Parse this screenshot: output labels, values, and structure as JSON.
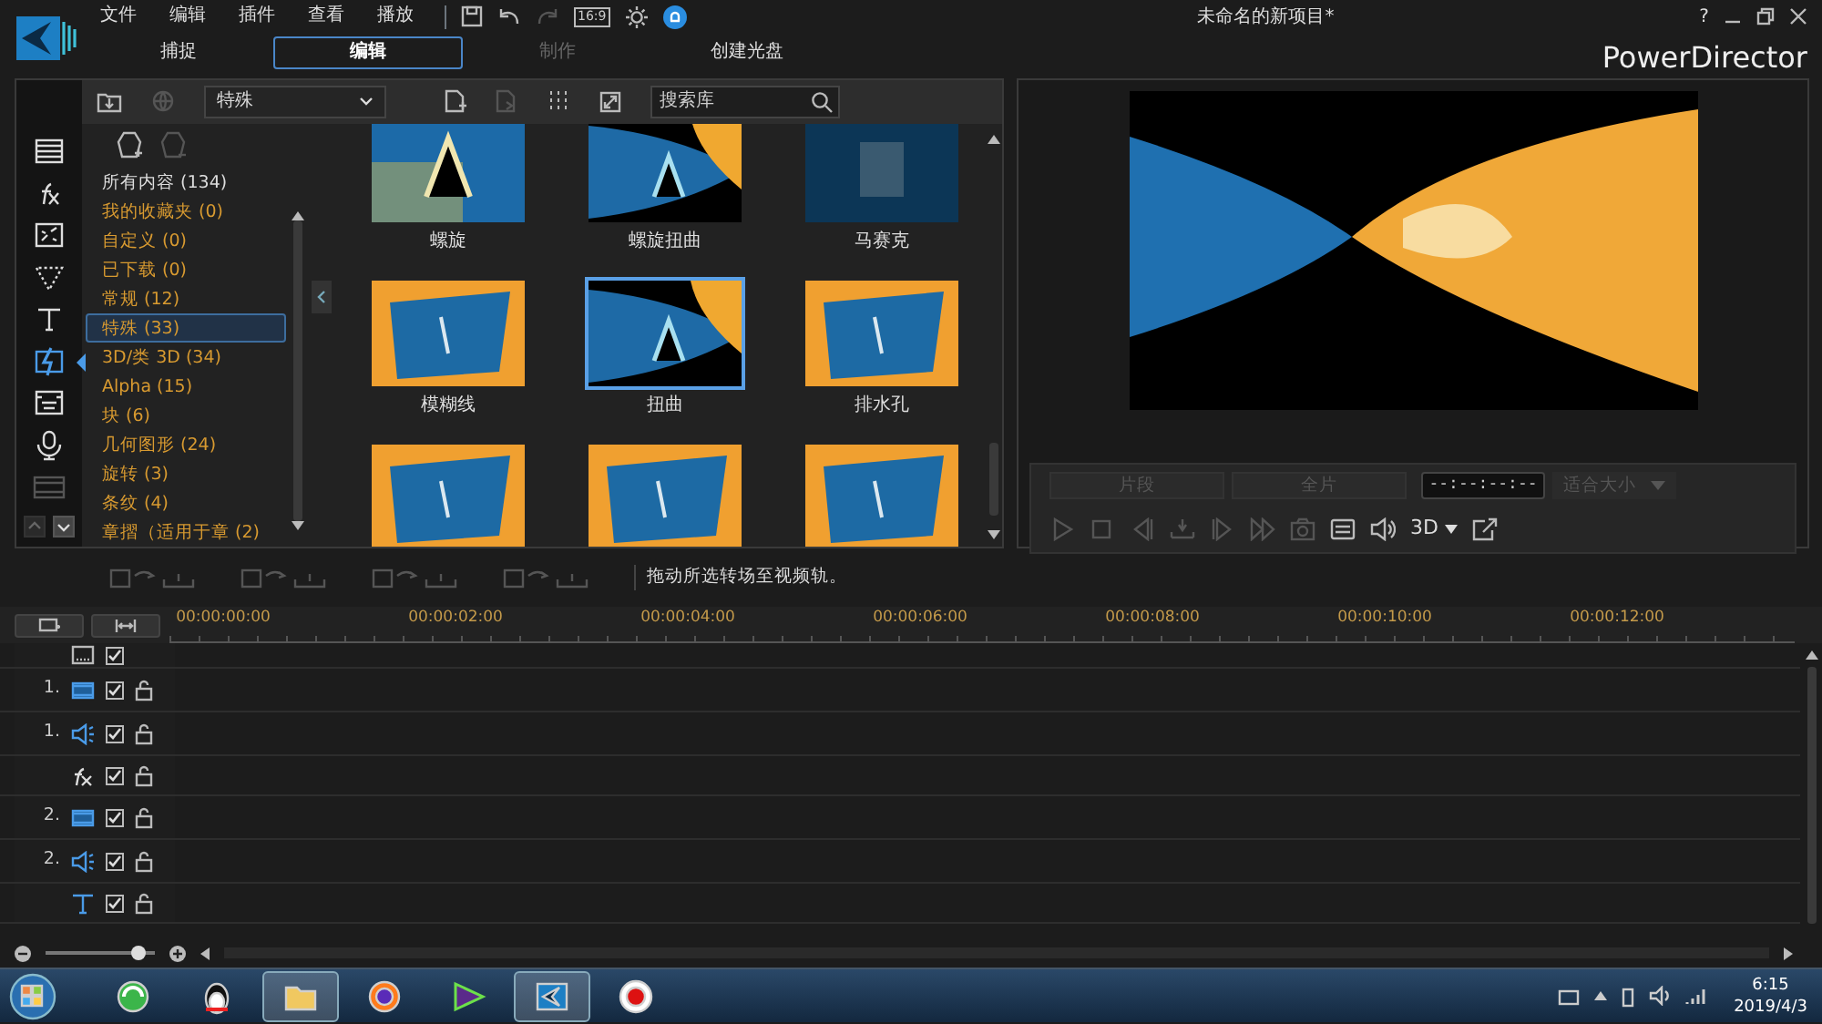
{
  "app": {
    "menu": [
      "文件",
      "编辑",
      "插件",
      "查看",
      "播放"
    ],
    "aspect": "16:9",
    "project_title": "未命名的新项目*",
    "help": "?",
    "brand": "PowerDirector"
  },
  "tabs": [
    {
      "label": "捕捉",
      "selected": false,
      "disabled": false
    },
    {
      "label": "编辑",
      "selected": true,
      "disabled": false
    },
    {
      "label": "制作",
      "selected": false,
      "disabled": true
    },
    {
      "label": "创建光盘",
      "selected": false,
      "disabled": false
    }
  ],
  "library": {
    "rooms": [
      {
        "kind": "media",
        "selected": false,
        "disabled": false
      },
      {
        "kind": "fx",
        "selected": false,
        "disabled": false
      },
      {
        "kind": "pip",
        "selected": false,
        "disabled": false
      },
      {
        "kind": "particle",
        "selected": false,
        "disabled": false
      },
      {
        "kind": "title",
        "selected": false,
        "disabled": false
      },
      {
        "kind": "transition",
        "selected": true,
        "disabled": false
      },
      {
        "kind": "subtitle",
        "selected": false,
        "disabled": false
      },
      {
        "kind": "voice",
        "selected": false,
        "disabled": false
      },
      {
        "kind": "chapter",
        "selected": false,
        "disabled": true
      }
    ],
    "filter": "特殊",
    "search": {
      "placeholder": "搜索库"
    },
    "categories": [
      {
        "label": "所有内容 (134)",
        "kind": "all",
        "selected": false
      },
      {
        "label": "我的收藏夹  (0)",
        "kind": "group",
        "selected": false
      },
      {
        "label": "自定义  (0)",
        "kind": "group",
        "selected": false
      },
      {
        "label": "已下载  (0)",
        "kind": "group",
        "selected": false
      },
      {
        "label": "常规  (12)",
        "kind": "group",
        "selected": false
      },
      {
        "label": "特殊  (33)",
        "kind": "group",
        "selected": true
      },
      {
        "label": "3D/类 3D  (34)",
        "kind": "group",
        "selected": false
      },
      {
        "label": "Alpha  (15)",
        "kind": "group",
        "selected": false
      },
      {
        "label": "块  (6)",
        "kind": "group",
        "selected": false
      },
      {
        "label": "几何图形  (24)",
        "kind": "group",
        "selected": false
      },
      {
        "label": "旋转  (3)",
        "kind": "group",
        "selected": false
      },
      {
        "label": "条纹  (4)",
        "kind": "group",
        "selected": false
      },
      {
        "label": "章摺（适用于章      (2)",
        "kind": "group",
        "selected": false
      }
    ],
    "thumbnails": [
      {
        "label": "螺旋",
        "kind": "blue",
        "selected": false
      },
      {
        "label": "螺旋扭曲",
        "kind": "black",
        "selected": false
      },
      {
        "label": "马赛克",
        "kind": "navy",
        "selected": false
      },
      {
        "label": "模糊线",
        "kind": "orange",
        "selected": false
      },
      {
        "label": "扭曲",
        "kind": "black",
        "selected": true
      },
      {
        "label": "排水孔",
        "kind": "orange",
        "selected": false
      },
      {
        "kind": "orange",
        "selected": false
      },
      {
        "kind": "orange",
        "selected": false
      },
      {
        "kind": "orange",
        "selected": false
      }
    ]
  },
  "preview": {
    "range_buttons": [
      {
        "label": "片段",
        "disabled": true
      },
      {
        "label": "全片",
        "disabled": true
      }
    ],
    "timecode": "--:--:--:--",
    "fit": "适合大小",
    "mode_3d": "3D"
  },
  "toolstrip": {
    "hint": "拖动所选转场至视频轨。"
  },
  "timeline": {
    "ruler": [
      "00:00:00:00",
      "00:00:02:00",
      "00:00:04:00",
      "00:00:06:00",
      "00:00:08:00",
      "00:00:10:00",
      "00:00:12:00"
    ],
    "tracks": [
      {
        "kind": "subtitle",
        "checked": true,
        "lockable": false
      },
      {
        "number": "1.",
        "kind": "video",
        "checked": true,
        "lockable": true
      },
      {
        "number": "1.",
        "kind": "audio",
        "checked": true,
        "lockable": true
      },
      {
        "kind": "fx",
        "checked": true,
        "lockable": true
      },
      {
        "number": "2.",
        "kind": "video",
        "checked": true,
        "lockable": true
      },
      {
        "number": "2.",
        "kind": "audio",
        "checked": true,
        "lockable": true
      },
      {
        "kind": "title",
        "checked": true,
        "lockable": true
      }
    ],
    "zoom": {
      "level": 0.85
    }
  },
  "taskbar": {
    "apps": [
      {
        "kind": "browser",
        "active": false
      },
      {
        "kind": "penguin",
        "active": false
      },
      {
        "kind": "folder",
        "active": true
      },
      {
        "kind": "firefox",
        "active": false
      },
      {
        "kind": "player",
        "active": false
      },
      {
        "kind": "editor",
        "active": true
      },
      {
        "kind": "recorder",
        "active": false
      }
    ],
    "time": "6:15",
    "date": "2019/4/3"
  }
}
